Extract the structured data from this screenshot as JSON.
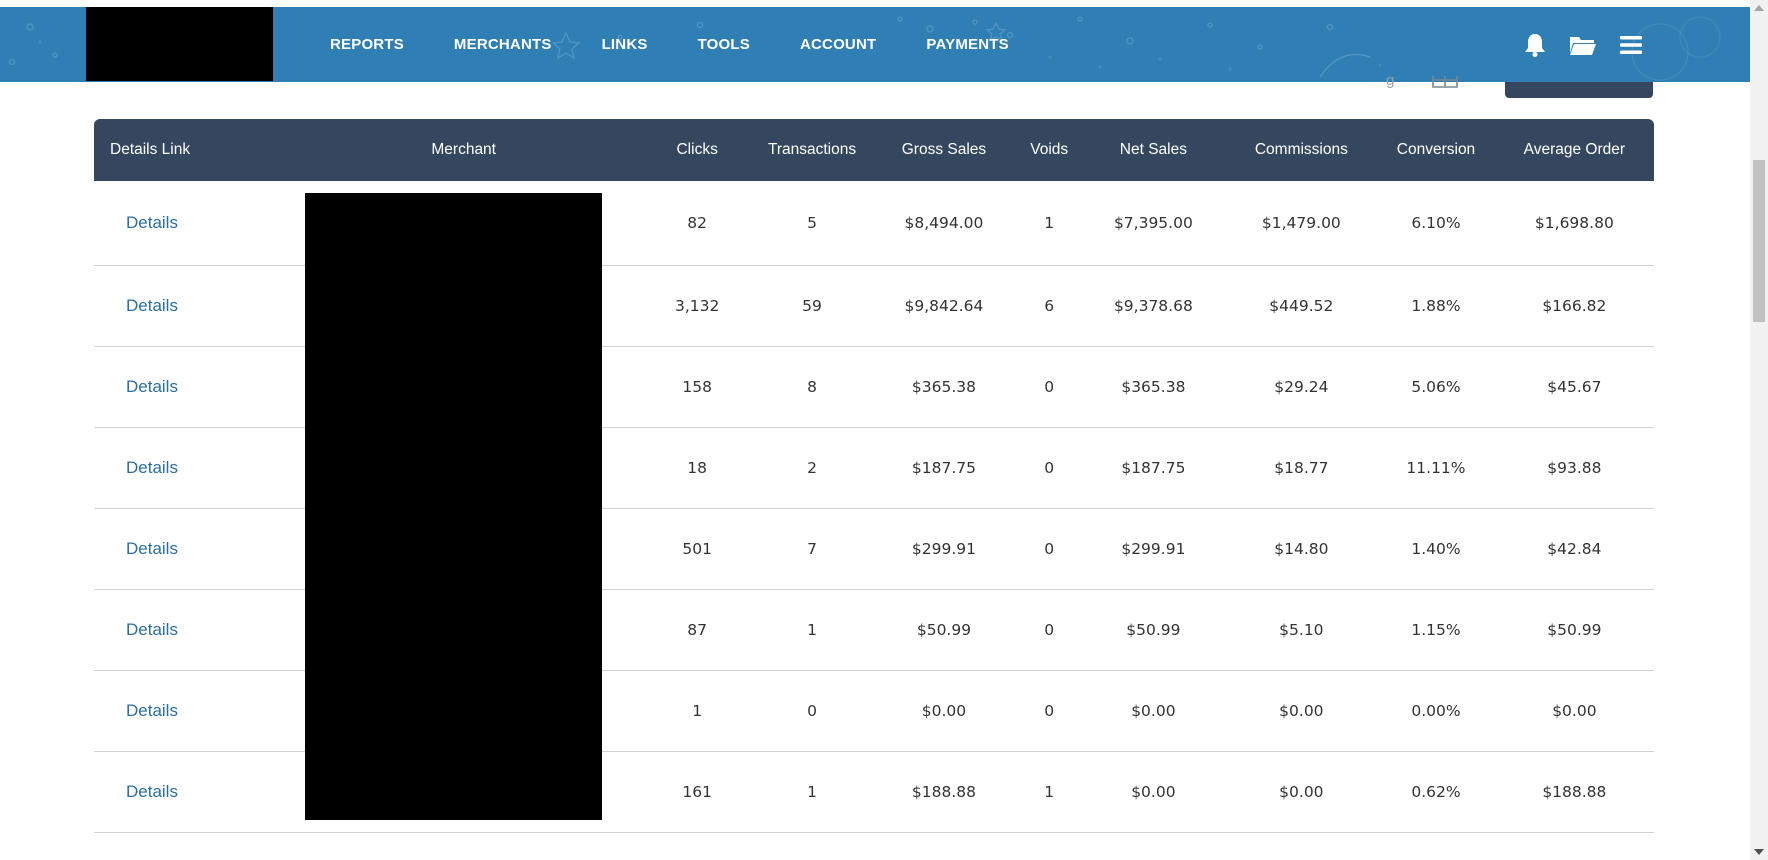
{
  "header": {
    "brand_color": "#2f7fb5",
    "nav_items": [
      "REPORTS",
      "MERCHANTS",
      "LINKS",
      "TOOLS",
      "ACCOUNT",
      "PAYMENTS"
    ],
    "icons": [
      "bell-icon",
      "folder-open-icon",
      "hamburger-menu-icon"
    ]
  },
  "toolbar": {
    "partial_text": "g"
  },
  "table": {
    "header_color": "#34475e",
    "link_color": "#2b6ea6",
    "columns": [
      "Details Link",
      "Merchant",
      "Clicks",
      "Transactions",
      "Gross Sales",
      "Voids",
      "Net Sales",
      "Commissions",
      "Conversion",
      "Average Order"
    ],
    "rows": [
      {
        "details": "Details",
        "merchant": "",
        "clicks": "82",
        "transactions": "5",
        "gross_sales": "$8,494.00",
        "voids": "1",
        "net_sales": "$7,395.00",
        "commissions": "$1,479.00",
        "conversion": "6.10%",
        "average_order": "$1,698.80"
      },
      {
        "details": "Details",
        "merchant": "",
        "clicks": "3,132",
        "transactions": "59",
        "gross_sales": "$9,842.64",
        "voids": "6",
        "net_sales": "$9,378.68",
        "commissions": "$449.52",
        "conversion": "1.88%",
        "average_order": "$166.82"
      },
      {
        "details": "Details",
        "merchant": "",
        "clicks": "158",
        "transactions": "8",
        "gross_sales": "$365.38",
        "voids": "0",
        "net_sales": "$365.38",
        "commissions": "$29.24",
        "conversion": "5.06%",
        "average_order": "$45.67"
      },
      {
        "details": "Details",
        "merchant": "",
        "clicks": "18",
        "transactions": "2",
        "gross_sales": "$187.75",
        "voids": "0",
        "net_sales": "$187.75",
        "commissions": "$18.77",
        "conversion": "11.11%",
        "average_order": "$93.88"
      },
      {
        "details": "Details",
        "merchant": "",
        "clicks": "501",
        "transactions": "7",
        "gross_sales": "$299.91",
        "voids": "0",
        "net_sales": "$299.91",
        "commissions": "$14.80",
        "conversion": "1.40%",
        "average_order": "$42.84"
      },
      {
        "details": "Details",
        "merchant": "",
        "clicks": "87",
        "transactions": "1",
        "gross_sales": "$50.99",
        "voids": "0",
        "net_sales": "$50.99",
        "commissions": "$5.10",
        "conversion": "1.15%",
        "average_order": "$50.99"
      },
      {
        "details": "Details",
        "merchant": "",
        "clicks": "1",
        "transactions": "0",
        "gross_sales": "$0.00",
        "voids": "0",
        "net_sales": "$0.00",
        "commissions": "$0.00",
        "conversion": "0.00%",
        "average_order": "$0.00"
      },
      {
        "details": "Details",
        "merchant": "",
        "clicks": "161",
        "transactions": "1",
        "gross_sales": "$188.88",
        "voids": "1",
        "net_sales": "$0.00",
        "commissions": "$0.00",
        "conversion": "0.62%",
        "average_order": "$188.88"
      }
    ]
  }
}
